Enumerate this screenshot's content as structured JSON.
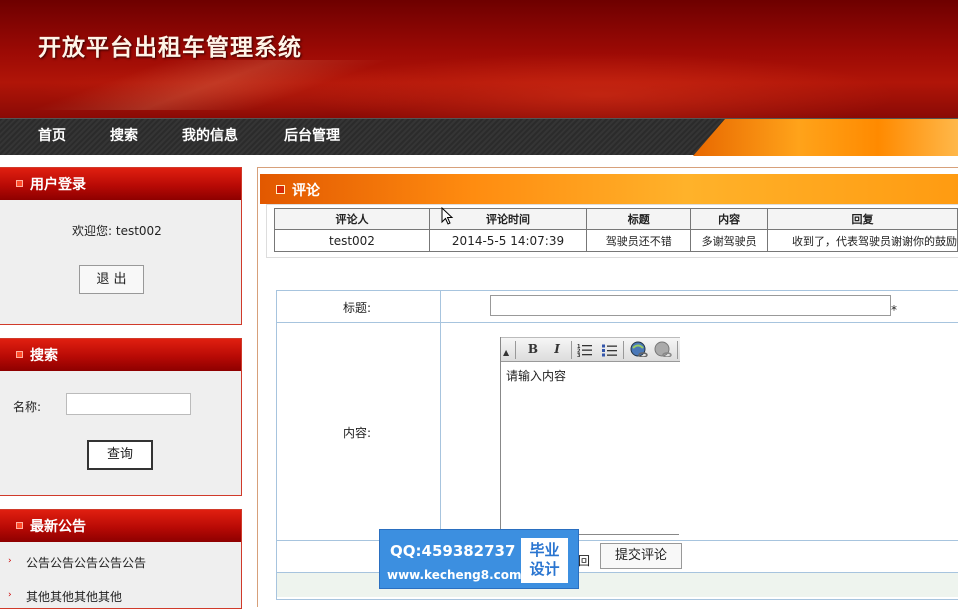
{
  "site": {
    "title": "开放平台出租车管理系统"
  },
  "nav": {
    "items": [
      "首页",
      "搜索",
      "我的信息",
      "后台管理"
    ]
  },
  "sidebar": {
    "login": {
      "title": "用户登录",
      "welcome": "欢迎您: test002",
      "logout_label": "退 出"
    },
    "search": {
      "title": "搜索",
      "name_label": "名称:",
      "name_value": "",
      "query_label": "查询"
    },
    "notice": {
      "title": "最新公告",
      "items": [
        "公告公告公告公告公告",
        "其他其他其他其他"
      ]
    }
  },
  "main": {
    "title": "评论",
    "comments_table": {
      "headers": [
        "评论人",
        "评论时间",
        "标题",
        "内容",
        "回复"
      ],
      "rows": [
        [
          "test002",
          "2014-5-5 14:07:39",
          "驾驶员还不错",
          "多谢驾驶员",
          "收到了，代表驾驶员谢谢你的鼓励"
        ]
      ]
    },
    "form": {
      "title_label": "标题:",
      "title_value": "",
      "required_mark": "*",
      "content_label": "内容:",
      "editor_text": "请输入内容",
      "reset_partial": "回",
      "submit_label": "提交评论"
    },
    "editor_toolbar": {
      "bold": "B",
      "italic": "I",
      "icons": [
        "collapse-icon",
        "bold-icon",
        "italic-icon",
        "ordered-list-icon",
        "unordered-list-icon",
        "link-icon",
        "unlink-icon"
      ]
    }
  },
  "watermark": {
    "qq": "QQ:459382737",
    "url": "www.kecheng8.com",
    "badge_line1": "毕业",
    "badge_line2": "设计"
  }
}
